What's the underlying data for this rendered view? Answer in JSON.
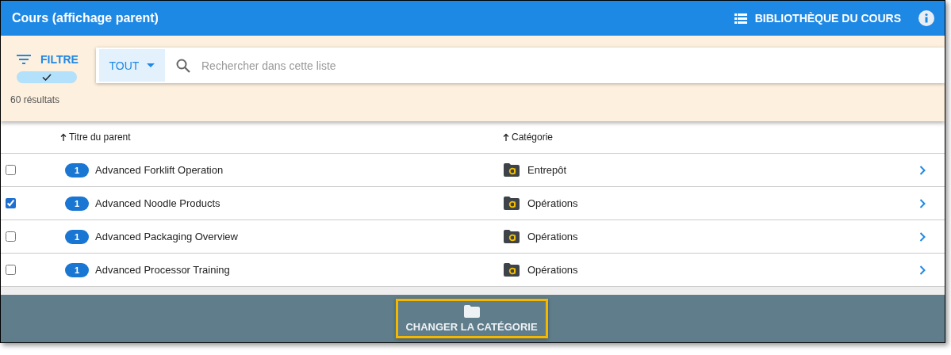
{
  "header": {
    "title": "Cours (affichage parent)",
    "library_button": "BIBLIOTHÈQUE DU COURS"
  },
  "filter": {
    "label": "FILTRE",
    "active": true,
    "scope": "TOUT",
    "search_placeholder": "Rechercher dans cette liste",
    "result_count": "60 résultats"
  },
  "table": {
    "columns": [
      {
        "label": "Titre du parent"
      },
      {
        "label": "Catégorie"
      }
    ],
    "rows": [
      {
        "checked": false,
        "count": "1",
        "title": "Advanced Forklift Operation",
        "category": "Entrepôt"
      },
      {
        "checked": true,
        "count": "1",
        "title": "Advanced Noodle Products",
        "category": "Opérations"
      },
      {
        "checked": false,
        "count": "1",
        "title": "Advanced Packaging Overview",
        "category": "Opérations"
      },
      {
        "checked": false,
        "count": "1",
        "title": "Advanced Processor Training",
        "category": "Opérations"
      }
    ]
  },
  "action_bar": {
    "button": "CHANGER LA CATÉGORIE",
    "highlighted": true
  }
}
